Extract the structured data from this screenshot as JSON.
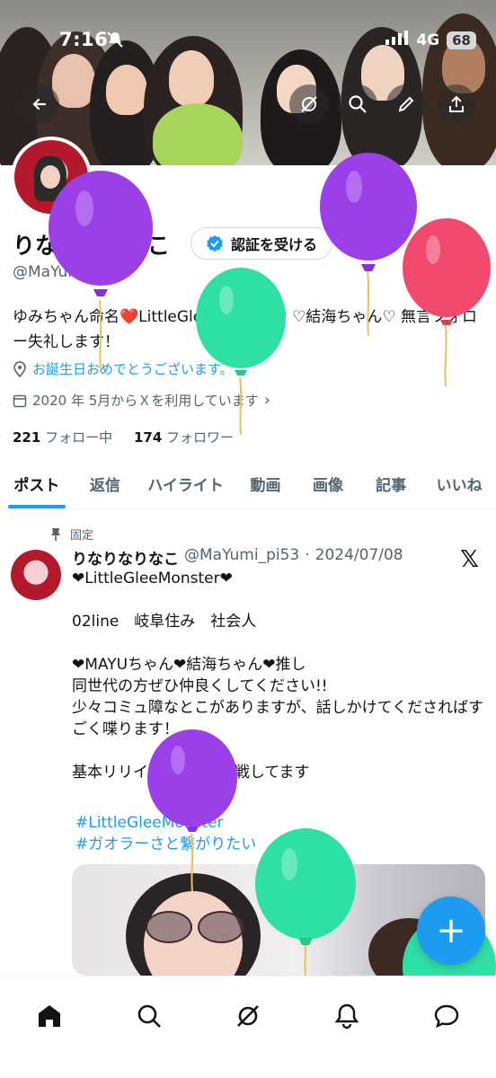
{
  "status_bar": {
    "time": "7:16",
    "network": "4G",
    "battery": "68"
  },
  "profile": {
    "name": "りなりなりなこ",
    "verify_label": "認証を受ける",
    "handle": "@MaYumi_pi53",
    "bio": "ゆみちゃん命名❤️LittleGleeMonster♡ ♡結海ちゃん♡ 無言フォロー失礼します！",
    "birthday_text": "お誕生日おめでとうございます。",
    "joined_text": "2020 年 5月からＸを利用しています",
    "following_count": "221",
    "following_label": "フォロー中",
    "followers_count": "174",
    "followers_label": "フォロワー"
  },
  "tabs": [
    {
      "label": "ポスト"
    },
    {
      "label": "返信"
    },
    {
      "label": "ハイライト"
    },
    {
      "label": "動画"
    },
    {
      "label": "画像"
    },
    {
      "label": "記事"
    },
    {
      "label": "いいね"
    }
  ],
  "post": {
    "pinned_label": "固定",
    "author_name": "りなりなりなこ",
    "author_handle": "@MaYumi_pi53",
    "separator": "·",
    "date": "2024/07/08",
    "body": "❤LittleGleeMonster❤\n\n02line　岐阜住み　社会人\n\n❤MAYUちゃん❤結海ちゃん❤推し\n同世代の方ぜひ仲良くしてください!!\n少々コミュ障なとこがありますが、話しかけてくださればすごく喋ります！\n\n基本リリイベは1人で参戦してます",
    "hashtag_1": "#LittleGleeMonster",
    "hashtag_2": "#ガオラーさと繋がりたい"
  },
  "fab_label": "+",
  "colors": {
    "accent": "#1d9bf0",
    "balloon_purple": "#9b3fe8",
    "balloon_green": "#2fe0a6",
    "balloon_red": "#f24a6e"
  }
}
